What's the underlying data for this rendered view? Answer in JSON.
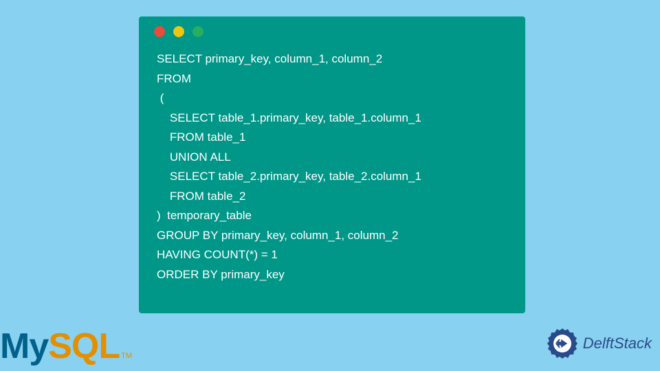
{
  "code": {
    "lines": [
      "SELECT primary_key, column_1, column_2",
      "FROM",
      " (",
      "    SELECT table_1.primary_key, table_1.column_1",
      "    FROM table_1",
      "    UNION ALL",
      "    SELECT table_2.primary_key, table_2.column_1",
      "    FROM table_2",
      ")  temporary_table",
      "GROUP BY primary_key, column_1, column_2",
      "HAVING COUNT(*) = 1",
      "ORDER BY primary_key"
    ]
  },
  "logos": {
    "mysql_my": "My",
    "mysql_sql": "SQL",
    "mysql_tm": "TM",
    "delftstack": "DelftStack"
  }
}
